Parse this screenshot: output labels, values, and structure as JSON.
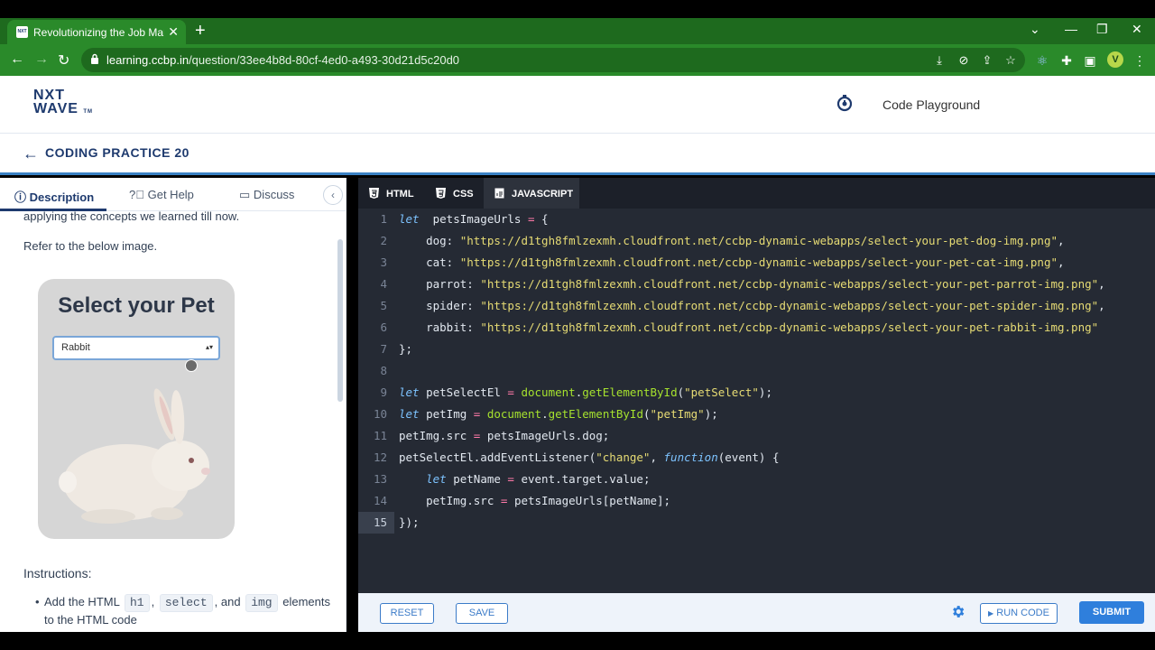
{
  "browser": {
    "tab_title": "Revolutionizing the Job Market |",
    "tab_favicon_text": "NXT WAVE",
    "url_host": "learning.ccbp.in",
    "url_path": "/question/33ee4b8d-80cf-4ed0-a493-30d21d5c20d0",
    "avatar_letter": "V",
    "theme_color": "#2a8a2a"
  },
  "site": {
    "logo_line1": "NXT",
    "logo_line2": "WAVE",
    "logo_tm": "TM",
    "playground_label": "Code Playground",
    "back_arrow": "←",
    "practice_title": "CODING PRACTICE 20"
  },
  "left_panel": {
    "tabs": [
      {
        "label": "Description",
        "icon": "info-icon"
      },
      {
        "label": "Get Help",
        "icon": "help-circle-icon"
      },
      {
        "label": "Discuss",
        "icon": "chat-icon"
      }
    ],
    "collapse_glyph": "‹",
    "intro_text": "applying the concepts we learned till now.",
    "refer_text": "Refer to the below image.",
    "preview": {
      "heading": "Select your Pet",
      "select_value": "Rabbit",
      "select_arrow": "▴▾"
    },
    "instructions_heading": "Instructions:",
    "instruction_1": {
      "prefix": "Add the HTML",
      "chip1": "h1",
      "sep1": ",",
      "chip2": "select",
      "sep2": ", and",
      "chip3": "img",
      "suffix": "elements to the HTML code"
    }
  },
  "editor": {
    "tabs": [
      {
        "label": "HTML",
        "icon": "html5-icon"
      },
      {
        "label": "CSS",
        "icon": "css3-icon"
      },
      {
        "label": "JAVASCRIPT",
        "icon": "js-file-icon"
      }
    ],
    "active_tab": "JAVASCRIPT",
    "current_line": 15,
    "lines": [
      {
        "n": "1",
        "segs": [
          [
            "kw",
            "let"
          ],
          [
            "",
            "  petsImageUrls "
          ],
          [
            "op",
            "="
          ],
          [
            "",
            " {"
          ]
        ]
      },
      {
        "n": "2",
        "segs": [
          [
            "",
            "    dog: "
          ],
          [
            "str",
            "\"https://d1tgh8fmlzexmh.cloudfront.net/ccbp-dynamic-webapps/select-your-pet-dog-img.png\""
          ],
          [
            "",
            ","
          ]
        ]
      },
      {
        "n": "3",
        "segs": [
          [
            "",
            "    cat: "
          ],
          [
            "str",
            "\"https://d1tgh8fmlzexmh.cloudfront.net/ccbp-dynamic-webapps/select-your-pet-cat-img.png\""
          ],
          [
            "",
            ","
          ]
        ]
      },
      {
        "n": "4",
        "segs": [
          [
            "",
            "    parrot: "
          ],
          [
            "str",
            "\"https://d1tgh8fmlzexmh.cloudfront.net/ccbp-dynamic-webapps/select-your-pet-parrot-img.png\""
          ],
          [
            "",
            ","
          ]
        ]
      },
      {
        "n": "5",
        "segs": [
          [
            "",
            "    spider: "
          ],
          [
            "str",
            "\"https://d1tgh8fmlzexmh.cloudfront.net/ccbp-dynamic-webapps/select-your-pet-spider-img.png\""
          ],
          [
            "",
            ","
          ]
        ]
      },
      {
        "n": "6",
        "segs": [
          [
            "",
            "    rabbit: "
          ],
          [
            "str",
            "\"https://d1tgh8fmlzexmh.cloudfront.net/ccbp-dynamic-webapps/select-your-pet-rabbit-img.png\""
          ]
        ]
      },
      {
        "n": "7",
        "segs": [
          [
            "",
            "};"
          ]
        ]
      },
      {
        "n": "8",
        "segs": [
          [
            "",
            ""
          ]
        ]
      },
      {
        "n": "9",
        "segs": [
          [
            "kw",
            "let"
          ],
          [
            "",
            " petSelectEl "
          ],
          [
            "op",
            "="
          ],
          [
            "",
            " "
          ],
          [
            "fn",
            "document"
          ],
          [
            "",
            "."
          ],
          [
            "fn",
            "getElementById"
          ],
          [
            "",
            "("
          ],
          [
            "str",
            "\"petSelect\""
          ],
          [
            "",
            ");"
          ]
        ]
      },
      {
        "n": "10",
        "segs": [
          [
            "kw",
            "let"
          ],
          [
            "",
            " petImg "
          ],
          [
            "op",
            "="
          ],
          [
            "",
            " "
          ],
          [
            "fn",
            "document"
          ],
          [
            "",
            "."
          ],
          [
            "fn",
            "getElementById"
          ],
          [
            "",
            "("
          ],
          [
            "str",
            "\"petImg\""
          ],
          [
            "",
            ");"
          ]
        ]
      },
      {
        "n": "11",
        "segs": [
          [
            "",
            "petImg.src "
          ],
          [
            "op",
            "="
          ],
          [
            "",
            " petsImageUrls.dog;"
          ]
        ]
      },
      {
        "n": "12",
        "segs": [
          [
            "",
            "petSelectEl.addEventListener("
          ],
          [
            "str",
            "\"change\""
          ],
          [
            "",
            ", "
          ],
          [
            "kw",
            "function"
          ],
          [
            "",
            "(event) {"
          ]
        ]
      },
      {
        "n": "13",
        "segs": [
          [
            "",
            "    "
          ],
          [
            "kw",
            "let"
          ],
          [
            "",
            " petName "
          ],
          [
            "op",
            "="
          ],
          [
            "",
            " event.target.value;"
          ]
        ]
      },
      {
        "n": "14",
        "segs": [
          [
            "",
            "    petImg.src "
          ],
          [
            "op",
            "="
          ],
          [
            "",
            " petsImageUrls[petName];"
          ]
        ]
      },
      {
        "n": "15",
        "segs": [
          [
            "",
            "});"
          ]
        ]
      }
    ]
  },
  "footer": {
    "reset_label": "RESET",
    "save_label": "SAVE",
    "run_label": "RUN CODE",
    "run_glyph": "▶",
    "submit_label": "SUBMIT",
    "accent_color": "#2f7fdc"
  }
}
